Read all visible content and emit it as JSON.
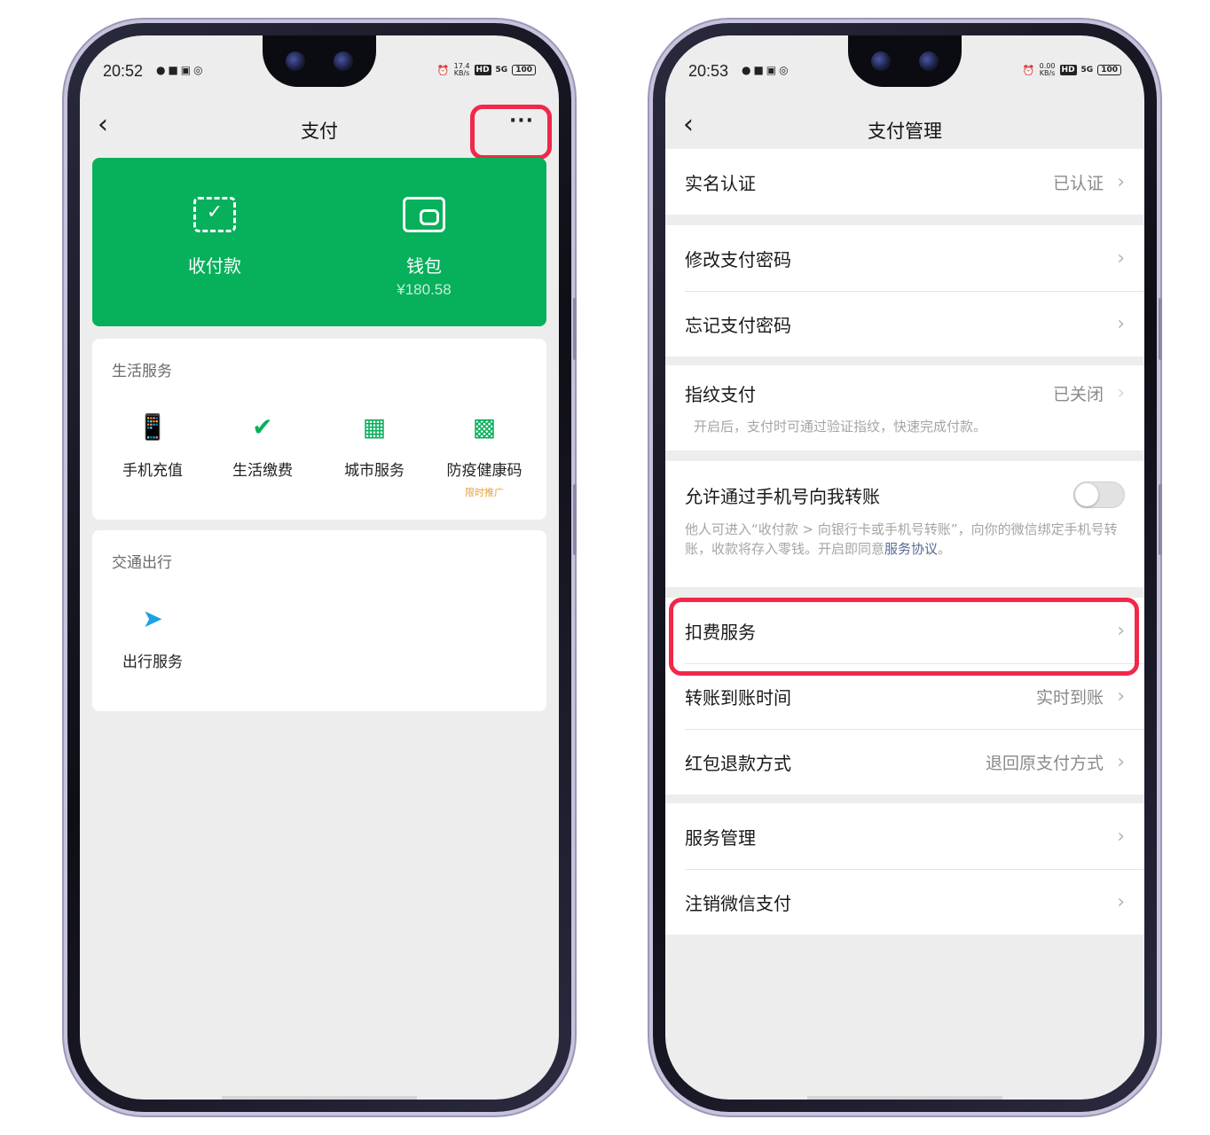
{
  "left_phone": {
    "status": {
      "time": "20:52",
      "net_speed": "17.4 KB/s",
      "hd": "HD",
      "signal": "5G",
      "battery": "100"
    },
    "nav": {
      "title": "支付",
      "back_icon": "chevron-left-icon",
      "more_label": "···"
    },
    "quick": [
      {
        "icon": "scan-pay-icon",
        "label": "收付款"
      },
      {
        "icon": "wallet-icon",
        "label": "钱包",
        "amount": "¥180.58"
      }
    ],
    "life_services": {
      "title": "生活服务",
      "items": [
        {
          "icon": "phone-recharge-icon",
          "label": "手机充值"
        },
        {
          "icon": "utility-bill-icon",
          "label": "生活缴费"
        },
        {
          "icon": "city-service-icon",
          "label": "城市服务"
        },
        {
          "icon": "qr-code-icon",
          "label": "防疫健康码",
          "badge": "限时推广"
        }
      ]
    },
    "transport": {
      "title": "交通出行",
      "items": [
        {
          "icon": "navigation-icon",
          "label": "出行服务"
        }
      ]
    },
    "colors": {
      "primary_green": "#07b05b",
      "highlight_red": "#f0284a"
    }
  },
  "right_phone": {
    "status": {
      "time": "20:53",
      "net_speed": "0.00 KB/s",
      "hd": "HD",
      "signal": "5G",
      "battery": "100"
    },
    "nav": {
      "title": "支付管理",
      "back_icon": "chevron-left-icon"
    },
    "rows": {
      "real_name": {
        "label": "实名认证",
        "value": "已认证"
      },
      "change_pwd": {
        "label": "修改支付密码"
      },
      "forgot_pwd": {
        "label": "忘记支付密码"
      },
      "fingerprint": {
        "label": "指纹支付",
        "value": "已关闭",
        "desc": "开启后，支付时可通过验证指纹，快速完成付款。"
      },
      "phone_transfer": {
        "label": "允许通过手机号向我转账",
        "toggle_on": false,
        "desc": "他人可进入“收付款 > 向银行卡或手机号转账”，向你的微信绑定手机号转账，收款将存入零钱。开启即同意",
        "link": "服务协议",
        "desc_end": "。"
      },
      "deduction": {
        "label": "扣费服务"
      },
      "transfer_time": {
        "label": "转账到账时间",
        "value": "实时到账"
      },
      "refund": {
        "label": "红包退款方式",
        "value": "退回原支付方式"
      },
      "service_mgmt": {
        "label": "服务管理"
      },
      "cancel_pay": {
        "label": "注销微信支付"
      }
    },
    "chevron": "›"
  }
}
